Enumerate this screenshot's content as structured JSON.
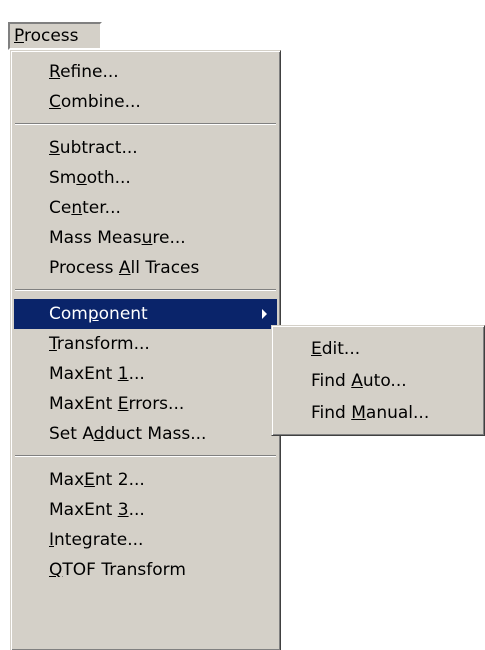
{
  "menubar": {
    "process": {
      "pre": "",
      "key": "P",
      "post": "rocess"
    }
  },
  "main_menu": {
    "refine": {
      "pre": "",
      "key": "R",
      "post": "efine..."
    },
    "combine": {
      "pre": "",
      "key": "C",
      "post": "ombine..."
    },
    "subtract": {
      "pre": "",
      "key": "S",
      "post": "ubtract..."
    },
    "smooth": {
      "pre": "Sm",
      "key": "o",
      "post": "oth..."
    },
    "center": {
      "pre": "Ce",
      "key": "n",
      "post": "ter..."
    },
    "mass_measure": {
      "pre": "Mass Meas",
      "key": "u",
      "post": "re..."
    },
    "process_all_traces": {
      "pre": "Process ",
      "key": "A",
      "post": "ll Traces"
    },
    "component": {
      "pre": "Com",
      "key": "p",
      "post": "onent"
    },
    "transform": {
      "pre": "",
      "key": "T",
      "post": "ransform..."
    },
    "maxent1": {
      "pre": "MaxEnt ",
      "key": "1",
      "post": "..."
    },
    "maxent_errors": {
      "pre": "MaxEnt ",
      "key": "E",
      "post": "rrors..."
    },
    "set_adduct_mass": {
      "pre": "Set A",
      "key": "d",
      "post": "duct Mass..."
    },
    "maxent2": {
      "pre": "Max",
      "key": "E",
      "post": "nt 2..."
    },
    "maxent3": {
      "pre": "MaxEnt ",
      "key": "3",
      "post": "..."
    },
    "integrate": {
      "pre": "",
      "key": "I",
      "post": "ntegrate..."
    },
    "qtof_transform": {
      "pre": "",
      "key": "Q",
      "post": "TOF Transform"
    }
  },
  "sub_menu": {
    "edit": {
      "pre": "",
      "key": "E",
      "post": "dit..."
    },
    "find_auto": {
      "pre": "Find ",
      "key": "A",
      "post": "uto..."
    },
    "find_manual": {
      "pre": "Find ",
      "key": "M",
      "post": "anual..."
    }
  },
  "colors": {
    "menu_face": "#d4d0c8",
    "highlight": "#0a246a",
    "highlight_text": "#ffffff"
  },
  "icons": {
    "submenu_arrow": "submenu-arrow-icon"
  }
}
